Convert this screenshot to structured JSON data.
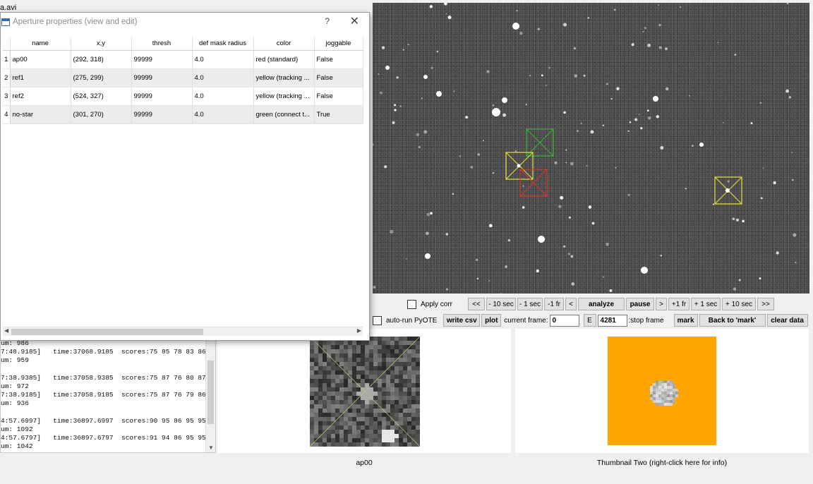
{
  "window": {
    "filename_fragment": "a.avi"
  },
  "dialog": {
    "title": "Aperture properties (view and edit)",
    "help_glyph": "?",
    "close_glyph": "✕",
    "columns": [
      "name",
      "x,y",
      "thresh",
      "def mask radius",
      "color",
      "joggable"
    ],
    "rows": [
      {
        "num": "1",
        "name": "ap00",
        "xy": "(292, 318)",
        "thresh": "99999",
        "radius": "4.0",
        "color": "red (standard)",
        "joggable": "False"
      },
      {
        "num": "2",
        "name": "ref1",
        "xy": "(275, 299)",
        "thresh": "99999",
        "radius": "4.0",
        "color": "yellow (tracking ...",
        "joggable": "False"
      },
      {
        "num": "3",
        "name": "ref2",
        "xy": "(524, 327)",
        "thresh": "99999",
        "radius": "4.0",
        "color": "yellow (tracking ...",
        "joggable": "False"
      },
      {
        "num": "4",
        "name": "no-star",
        "xy": "(301, 270)",
        "thresh": "99999",
        "radius": "4.0",
        "color": "green (connect t...",
        "joggable": "True"
      }
    ]
  },
  "controls": {
    "apply_corr": "Apply corr",
    "nav": [
      "<<",
      "- 10 sec",
      "- 1 sec",
      "-1 fr",
      "<"
    ],
    "analyze": "analyze",
    "pause": "pause",
    "nav2": [
      ">",
      "+1 fr",
      "+ 1 sec",
      "+ 10 sec",
      ">>"
    ],
    "auto_run": "auto-run PyOTE",
    "write_csv": "write csv",
    "plot": "plot",
    "current_frame_label": "current frame:",
    "current_frame": "0",
    "e_button": "E",
    "stop_frame": "4281",
    "stop_frame_label": ":stop frame",
    "mark": "mark",
    "back_to_mark": "Back to 'mark'",
    "clear_data": "clear data"
  },
  "log_lines": [
    "um: 986",
    "7:48.9185]   time:37068.9185  scores:75 85 78 83 86",
    "um: 959",
    "",
    "7:38.9385]   time:37058.9385  scores:75 87 76 80 87",
    "um: 972",
    "7:38.9185]   time:37058.9185  scores:75 87 76 79 86",
    "um: 936",
    "",
    "4:57.6997]   time:36897.6997  scores:90 95 86 95 95",
    "um: 1092",
    "4:57.6797]   time:36897.6797  scores:91 94 86 95 95",
    "um: 1042"
  ],
  "thumbnails": {
    "one_caption": "ap00",
    "two_caption": "Thumbnail Two (right-click here for info)",
    "two_bg_color": "#ffa500"
  },
  "colors": {
    "aperture_red": "#d83a2a",
    "aperture_yellow": "#e8e23a",
    "aperture_green": "#3cb43c",
    "image_bg": "#454545"
  }
}
